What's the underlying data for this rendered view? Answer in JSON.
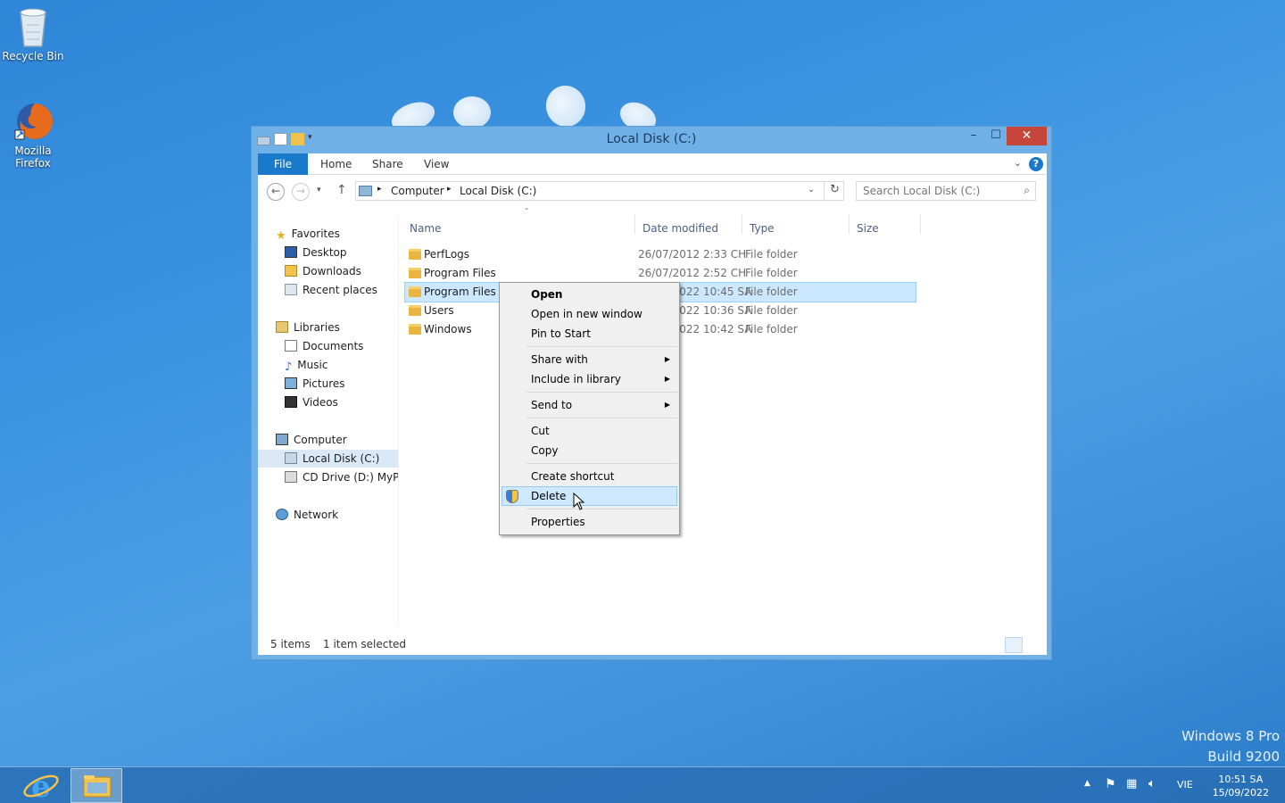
{
  "desktop": {
    "icons": [
      {
        "label": "Recycle Bin",
        "icon": "recycle-bin-icon"
      },
      {
        "label": "Mozilla Firefox",
        "icon": "firefox-icon"
      }
    ],
    "watermark_line1": "Windows 8 Pro",
    "watermark_line2": "Build 9200"
  },
  "window": {
    "title": "Local Disk (C:)",
    "buttons": {
      "minimize": "–",
      "maximize": "☐",
      "close": "✕"
    },
    "ribbon_tabs": [
      "File",
      "Home",
      "Share",
      "View"
    ],
    "address": {
      "crumbs": [
        "Computer",
        "Local Disk (C:)"
      ]
    },
    "search": {
      "placeholder": "Search Local Disk (C:)"
    },
    "nav": {
      "favorites": {
        "label": "Favorites",
        "items": [
          "Desktop",
          "Downloads",
          "Recent places"
        ]
      },
      "libraries": {
        "label": "Libraries",
        "items": [
          "Documents",
          "Music",
          "Pictures",
          "Videos"
        ]
      },
      "computer": {
        "label": "Computer",
        "items": [
          "Local Disk (C:)",
          "CD Drive (D:) MyPal"
        ]
      },
      "network": {
        "label": "Network"
      }
    },
    "columns": [
      "Name",
      "Date modified",
      "Type",
      "Size"
    ],
    "files": [
      {
        "name": "PerfLogs",
        "date": "26/07/2012 2:33 CH",
        "type": "File folder"
      },
      {
        "name": "Program Files",
        "date": "26/07/2012 2:52 CH",
        "type": "File folder"
      },
      {
        "name": "Program Files (x86)",
        "date": "15/09/2022 10:45 SA",
        "type": "File folder"
      },
      {
        "name": "Users",
        "date": "15/09/2022 10:36 SA",
        "type": "File folder"
      },
      {
        "name": "Windows",
        "date": "15/09/2022 10:42 SA",
        "type": "File folder"
      }
    ],
    "status": {
      "count": "5 items",
      "selected": "1 item selected"
    }
  },
  "context_menu": {
    "open": "Open",
    "open_new_window": "Open in new window",
    "pin_to_start": "Pin to Start",
    "share_with": "Share with",
    "include_in_library": "Include in library",
    "send_to": "Send to",
    "cut": "Cut",
    "copy": "Copy",
    "create_shortcut": "Create shortcut",
    "delete": "Delete",
    "properties": "Properties"
  },
  "taskbar": {
    "language": "VIE",
    "time": "10:51 SA",
    "date": "15/09/2022"
  },
  "colors": {
    "accent": "#1979ca",
    "selection": "#cce8ff",
    "close_button": "#c7463b"
  }
}
